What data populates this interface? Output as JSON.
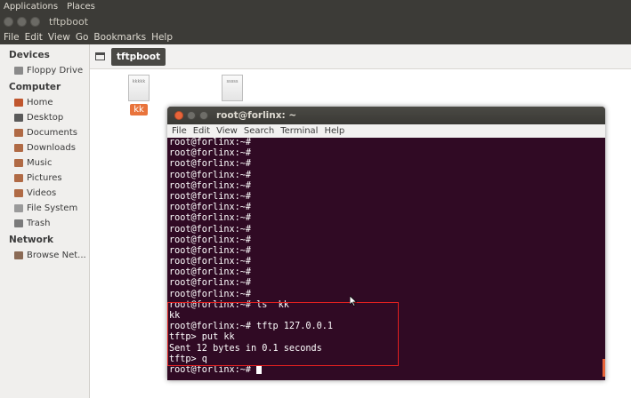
{
  "topbar": {
    "applications": "Applications",
    "places": "Places"
  },
  "file_manager": {
    "title": "tftpboot",
    "menu": [
      "File",
      "Edit",
      "View",
      "Go",
      "Bookmarks",
      "Help"
    ],
    "path_button": "tftpboot",
    "sidebar": {
      "devices_header": "Devices",
      "devices": [
        "Floppy Drive"
      ],
      "computer_header": "Computer",
      "computer": [
        "Home",
        "Desktop",
        "Documents",
        "Downloads",
        "Music",
        "Pictures",
        "Videos",
        "File System",
        "Trash"
      ],
      "network_header": "Network",
      "network": [
        "Browse Net..."
      ]
    },
    "files": [
      {
        "name": "kk",
        "preview": "kkkkk"
      },
      {
        "name": "",
        "preview": "sssss"
      }
    ]
  },
  "terminal": {
    "title": "root@forlinx: ~",
    "menu": [
      "File",
      "Edit",
      "View",
      "Search",
      "Terminal",
      "Help"
    ],
    "lines": [
      "root@forlinx:~#",
      "root@forlinx:~#",
      "root@forlinx:~#",
      "root@forlinx:~#",
      "root@forlinx:~#",
      "root@forlinx:~#",
      "root@forlinx:~#",
      "root@forlinx:~#",
      "root@forlinx:~#",
      "root@forlinx:~#",
      "root@forlinx:~#",
      "root@forlinx:~#",
      "root@forlinx:~#",
      "root@forlinx:~#",
      "root@forlinx:~#",
      "root@forlinx:~# ls  kk",
      "kk",
      "root@forlinx:~# tftp 127.0.0.1",
      "tftp> put kk",
      "Sent 12 bytes in 0.1 seconds",
      "tftp> q"
    ],
    "prompt": "root@forlinx:~# "
  },
  "colors": {
    "terminal_bg": "#300a24",
    "accent": "#e9743c",
    "highlight_box": "#e02020"
  }
}
